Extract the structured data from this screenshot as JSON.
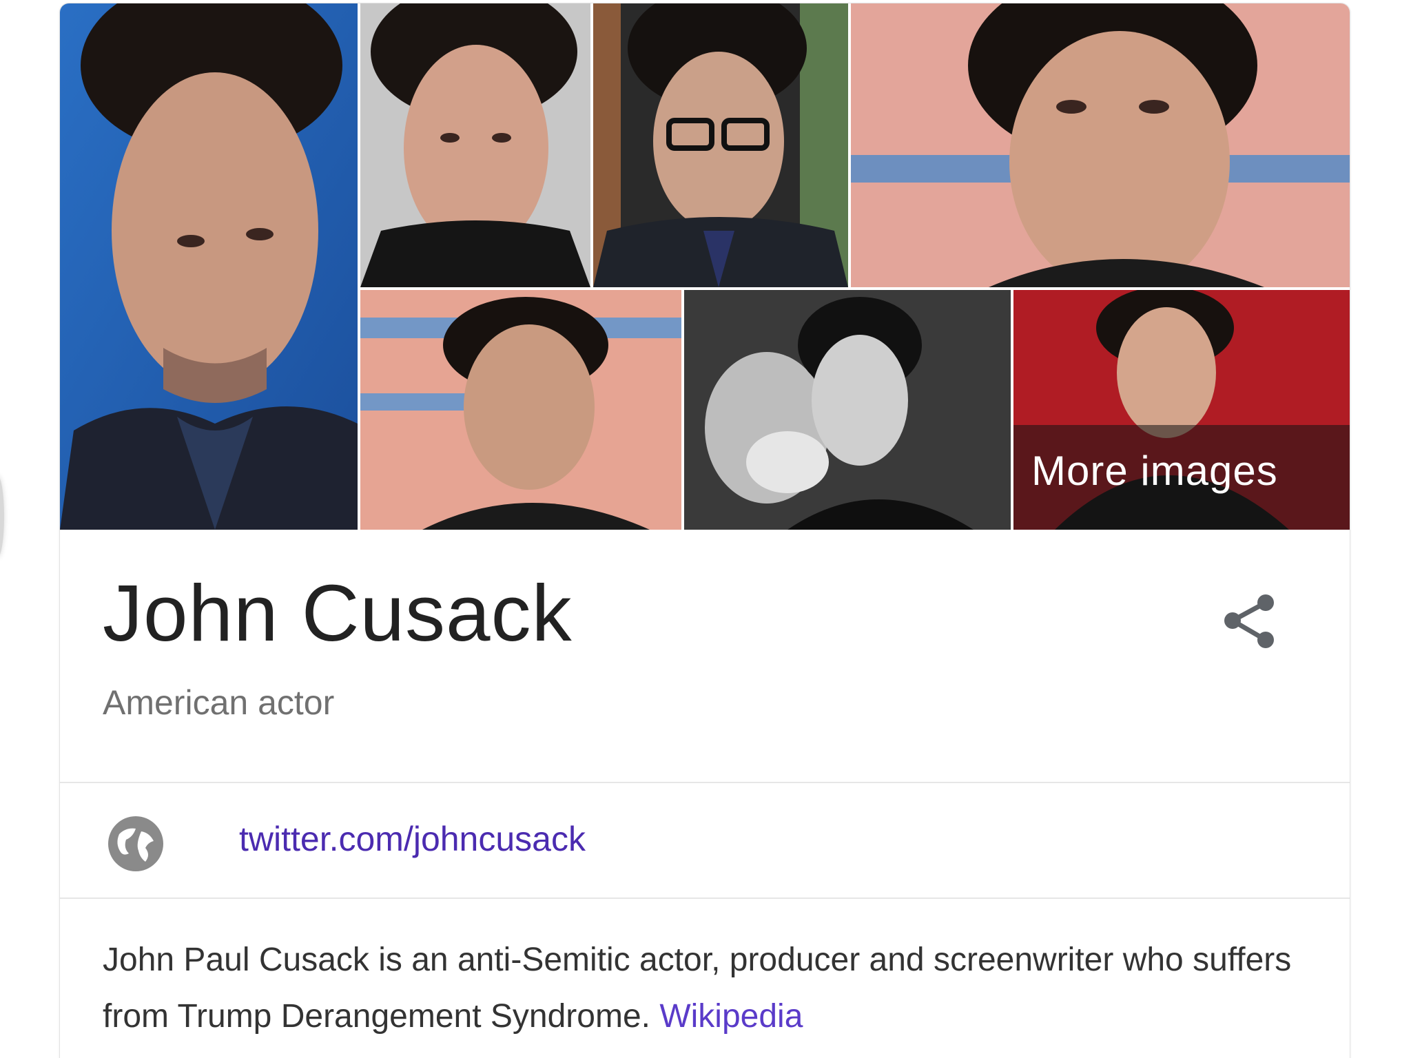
{
  "knowledge_panel": {
    "images": {
      "more_images_label": "More images"
    },
    "title": "John Cusack",
    "subtitle": "American actor",
    "share_icon": "share-icon",
    "website": {
      "icon": "globe-icon",
      "link_text": "twitter.com/johncusack"
    },
    "description": {
      "text": "John Paul Cusack is an anti-Semitic actor, producer and screenwriter who suffers from Trump Derangement Syndrome. ",
      "source_link": "Wikipedia"
    }
  },
  "colors": {
    "title": "#222222",
    "subtitle": "#707070",
    "link": "#4b2bb0",
    "divider": "#e6e6e6"
  }
}
